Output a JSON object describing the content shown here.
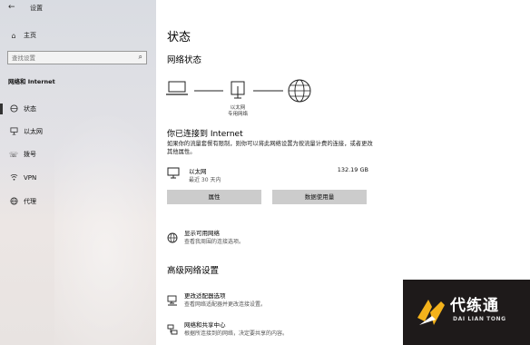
{
  "window": {
    "app_title": "设置"
  },
  "sidebar": {
    "home_label": "主页",
    "search_placeholder": "查找设置",
    "section_title": "网络和 Internet",
    "items": [
      {
        "label": "状态",
        "icon": "globe-status-icon",
        "active": true
      },
      {
        "label": "以太网",
        "icon": "ethernet-icon",
        "active": false
      },
      {
        "label": "拨号",
        "icon": "phone-icon",
        "active": false
      },
      {
        "label": "VPN",
        "icon": "vpn-icon",
        "active": false
      },
      {
        "label": "代理",
        "icon": "globe-icon",
        "active": false
      }
    ]
  },
  "main": {
    "page_title": "状态",
    "network_status_heading": "网络状态",
    "diagram_caption_line1": "以太网",
    "diagram_caption_line2": "专用网络",
    "connected_title": "你已连接到 Internet",
    "connected_desc": "如果你的流量套餐有限制，则你可以将此网络设置为按流量计费的连接，或者更改其他属性。",
    "adapter": {
      "name": "以太网",
      "sub": "最近 30 天内",
      "data_used": "132.19 GB"
    },
    "buttons": {
      "properties": "属性",
      "data_usage": "数据使用量"
    },
    "show_networks": {
      "title": "显示可用网络",
      "sub": "查看我周围的连接选项。"
    },
    "advanced_heading": "高级网络设置",
    "change_adapter": {
      "title": "更改适配器选项",
      "sub": "查看网络适配器并更改连接设置。"
    },
    "sharing_center": {
      "title": "网络和共享中心",
      "sub": "根据所连接到的网络，决定要共享的内容。"
    }
  },
  "watermark": {
    "main_text": "代练通",
    "sub_text": "DAI LIAN TONG"
  }
}
